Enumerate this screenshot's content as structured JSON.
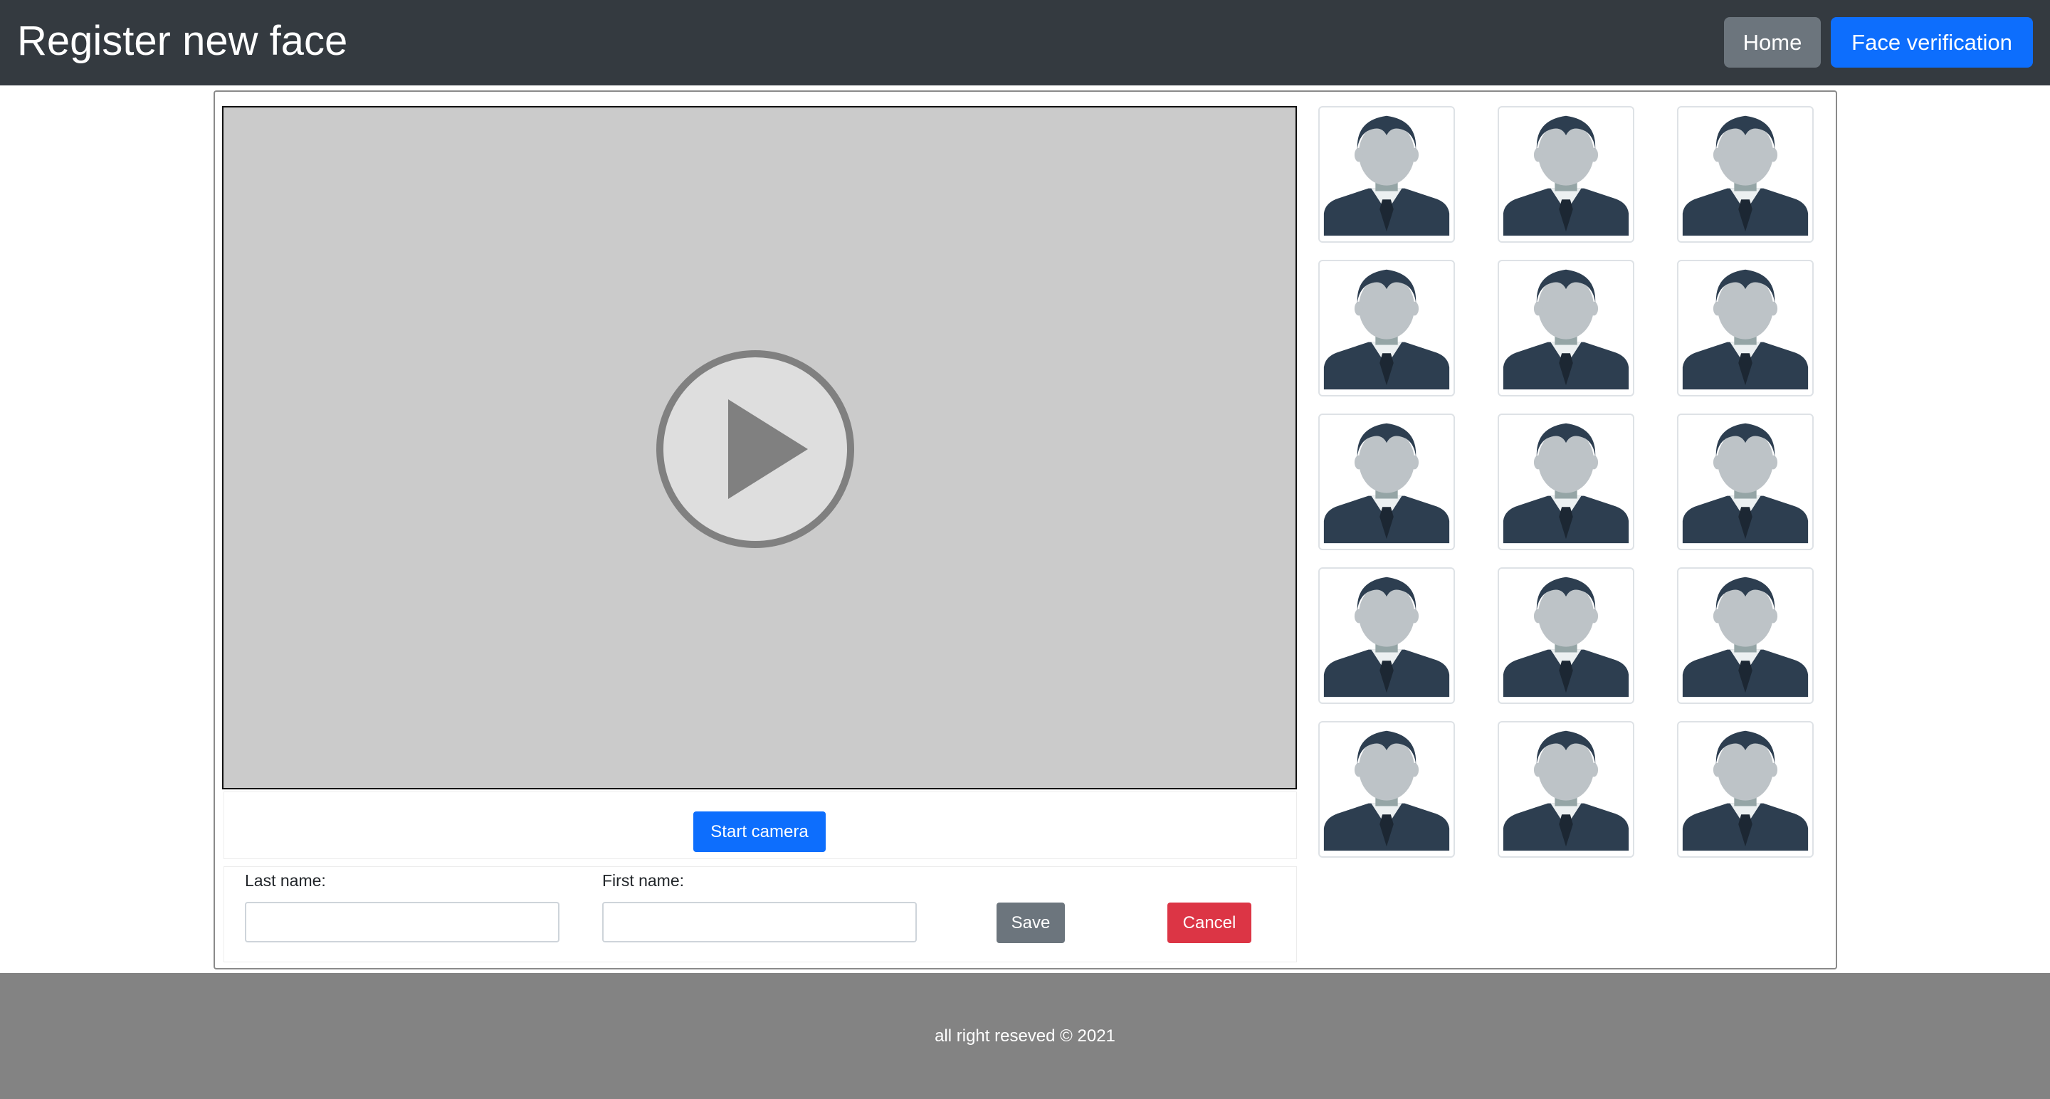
{
  "header": {
    "title": "Register new face",
    "nav": {
      "home_label": "Home",
      "verify_label": "Face verification"
    }
  },
  "video": {
    "icon": "play-icon"
  },
  "camera": {
    "start_label": "Start camera"
  },
  "form": {
    "last_name_label": "Last name:",
    "last_name_value": "",
    "first_name_label": "First name:",
    "first_name_value": "",
    "save_label": "Save",
    "cancel_label": "Cancel"
  },
  "thumbnails": {
    "icon": "person-placeholder-icon",
    "count": 15,
    "columns": 3
  },
  "footer": {
    "text": "all right reseved © 2021"
  },
  "colors": {
    "navbar": "#343a40",
    "primary": "#0d6efd",
    "secondary": "#6c757d",
    "danger": "#dc3545",
    "footer": "#838383"
  }
}
